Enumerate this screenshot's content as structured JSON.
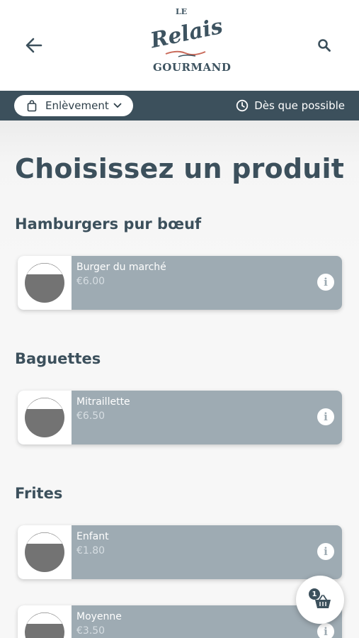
{
  "header": {
    "logo": {
      "top": "LE",
      "main": "Relais",
      "bottom": "GOURMAND"
    },
    "back_icon": "arrow-left-icon",
    "search_icon": "search-icon"
  },
  "mode_bar": {
    "mode_label": "Enlèvement",
    "time_label": "Dès que possible"
  },
  "page_title": "Choisissez un produit",
  "sections": [
    {
      "title": "Hamburgers pur bœuf",
      "items": [
        {
          "name": "Burger du marché",
          "price": "€6.00"
        }
      ]
    },
    {
      "title": "Baguettes",
      "items": [
        {
          "name": "Mitraillette",
          "price": "€6.50"
        }
      ]
    },
    {
      "title": "Frites",
      "items": [
        {
          "name": "Enfant",
          "price": "€1.80"
        },
        {
          "name": "Moyenne",
          "price": "€3.50"
        }
      ]
    }
  ],
  "cart": {
    "count": "1"
  },
  "colors": {
    "primary": "#3c505c",
    "card": "#9eabb3"
  }
}
